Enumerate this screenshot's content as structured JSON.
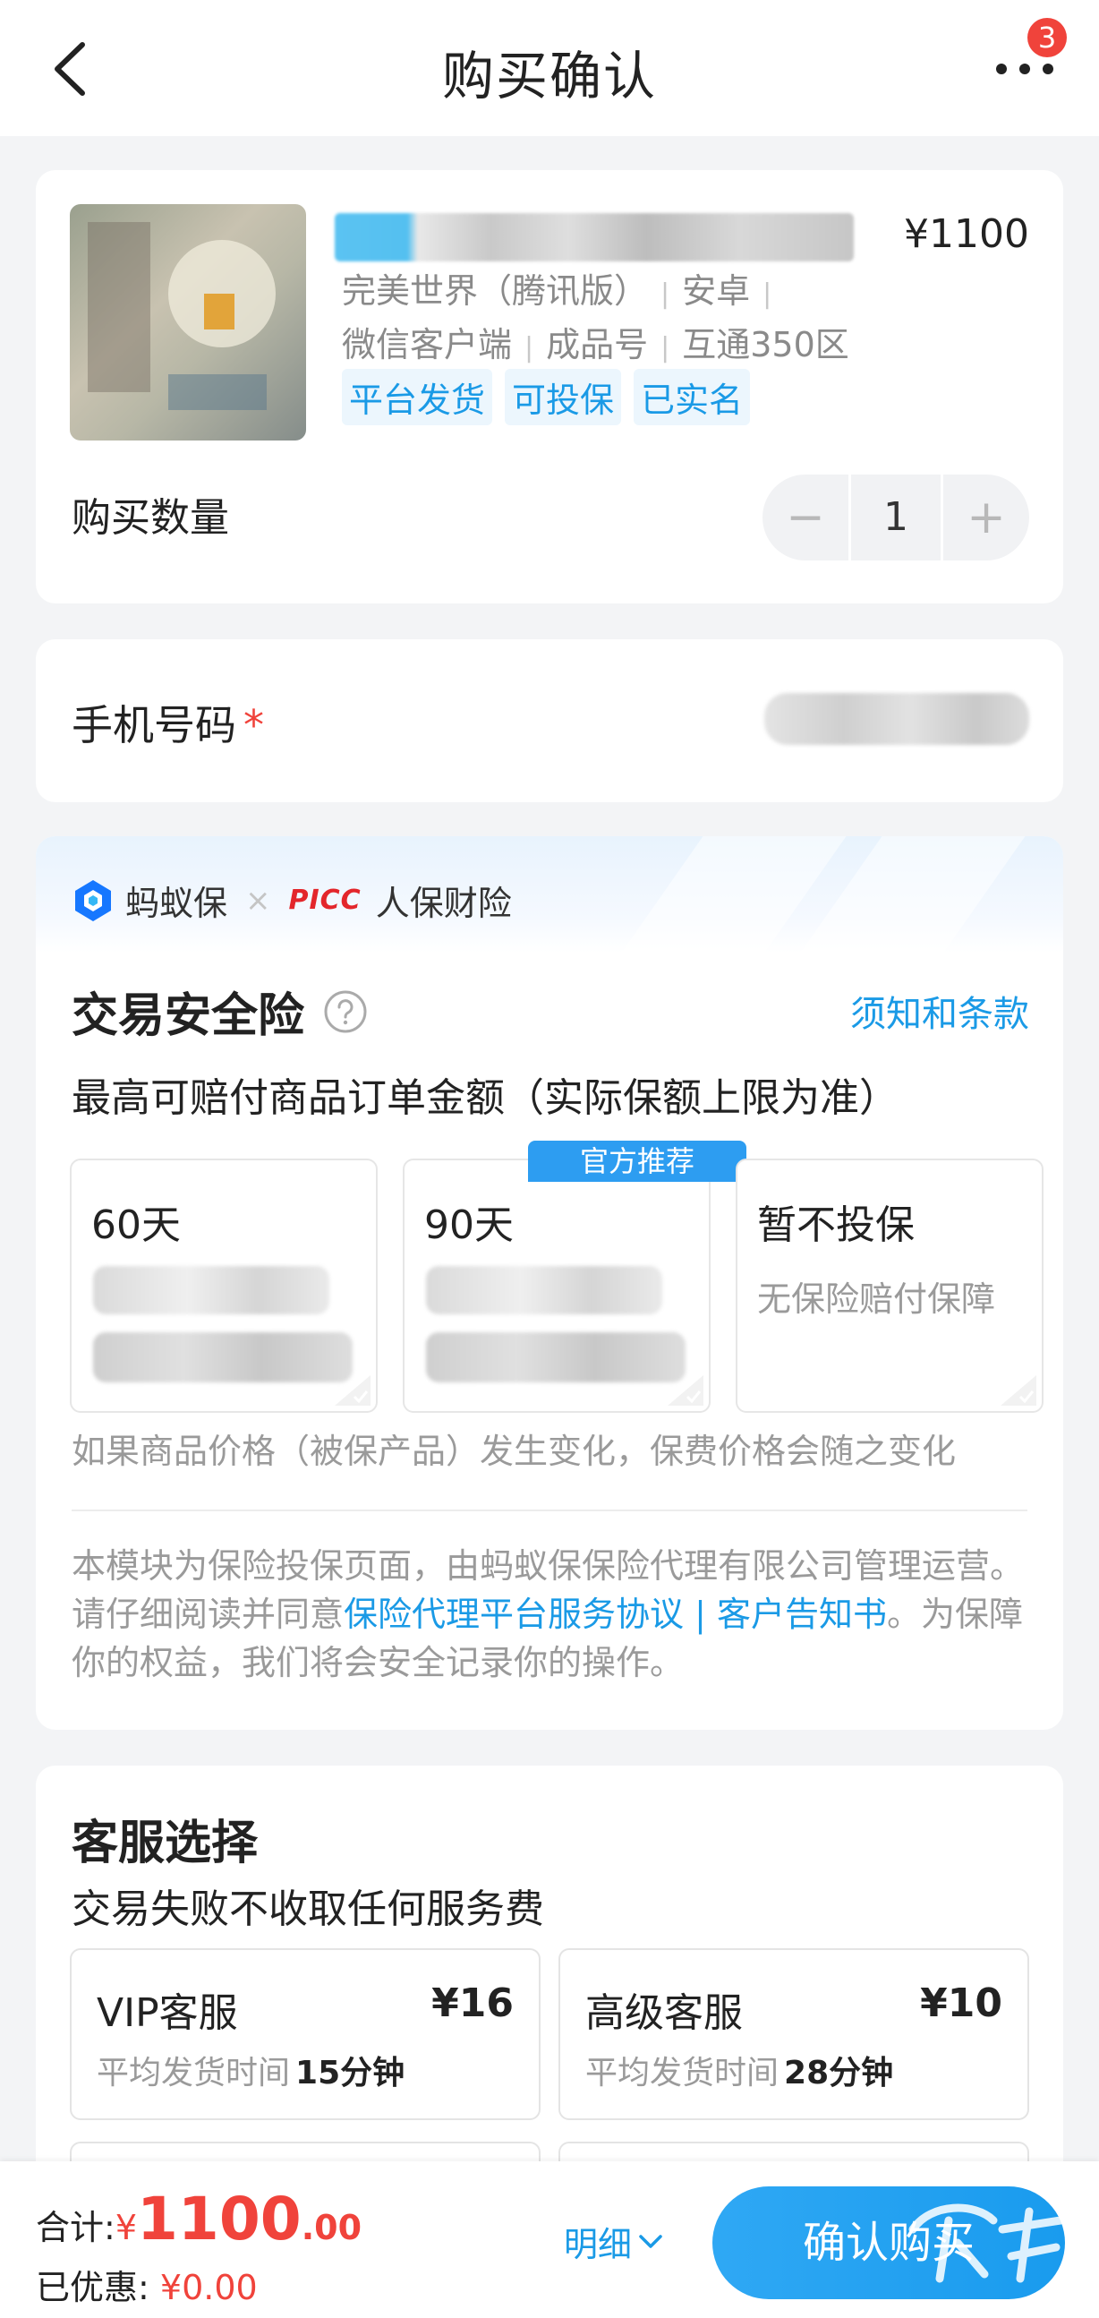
{
  "header": {
    "title": "购买确认",
    "badge_count": "3"
  },
  "product": {
    "price": "¥1100",
    "meta_line1": [
      "完美世界（腾讯版）",
      "安卓"
    ],
    "meta_line2": [
      "微信客户端",
      "成品号",
      "互通350区"
    ],
    "tags": [
      "平台发货",
      "可投保",
      "已实名"
    ],
    "quantity_label": "购买数量",
    "quantity": "1",
    "minus": "−",
    "plus": "+"
  },
  "phone": {
    "label": "手机号码",
    "required_mark": "*"
  },
  "insurance": {
    "brand1": "蚂蚁保",
    "times": "×",
    "picc_logo": "PICC",
    "brand2": "人保财险",
    "title": "交易安全险",
    "terms_link": "须知和条款",
    "description": "最高可赔付商品订单金额（实际保额上限为准）",
    "options": [
      {
        "name": "60天"
      },
      {
        "name": "90天",
        "badge": "官方推荐"
      },
      {
        "name": "暂不投保",
        "sub": "无保险赔付保障"
      }
    ],
    "note": "如果商品价格（被保产品）发生变化，保费价格会随之变化",
    "legal_prefix": "本模块为保险投保页面，由蚂蚁保保险代理有限公司管理运营。请仔细阅读并同意",
    "legal_link": "保险代理平台服务协议 | 客户告知书",
    "legal_suffix": "。为保障你的权益，我们将会安全记录你的操作。"
  },
  "service": {
    "title": "客服选择",
    "description": "交易失败不收取任何服务费",
    "options": [
      {
        "name": "VIP客服",
        "price": "¥16",
        "time_label": "平均发货时间",
        "time_value": "15分钟"
      },
      {
        "name": "高级客服",
        "price": "¥10",
        "time_label": "平均发货时间",
        "time_value": "28分钟"
      }
    ]
  },
  "footer": {
    "total_label": "合计:",
    "currency": "¥",
    "total_int": "1100",
    "total_dec": ".00",
    "discount_label": "已优惠:",
    "discount_value": "¥0.00",
    "detail_label": "明细",
    "confirm_label": "确认购买"
  },
  "colors": {
    "accent": "#1a9ae6",
    "price_red": "#f0433b",
    "button": "#199bee",
    "background": "#f3f4f6"
  }
}
